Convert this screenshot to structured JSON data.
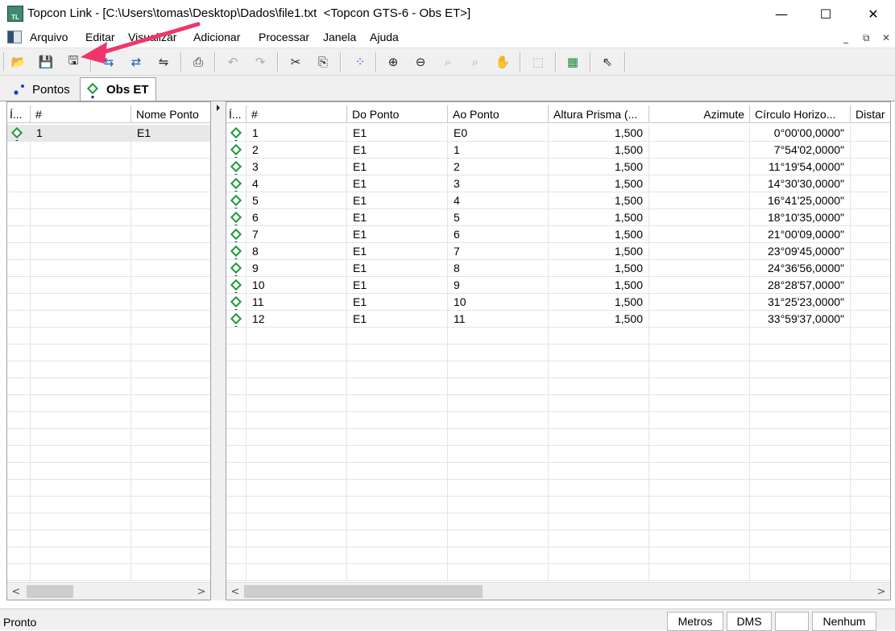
{
  "window": {
    "title": "Topcon Link - [C:\\Users\\tomas\\Desktop\\Dados\\file1.txt  <Topcon GTS-6 - Obs ET>]",
    "app_icon_text": "TL",
    "controls": {
      "minimize": "—",
      "maximize": "☐",
      "close": "✕"
    }
  },
  "menu": {
    "items": [
      "Arquivo",
      "Editar",
      "Visualizar",
      "Adicionar",
      "Processar",
      "Janela",
      "Ajuda"
    ],
    "mdi_controls": [
      "_",
      "⧉",
      "✕"
    ]
  },
  "toolbar": {
    "buttons": [
      {
        "icon": "open-folder-icon",
        "glyph": "📂"
      },
      {
        "icon": "save-disabled-icon",
        "glyph": "💾"
      },
      {
        "icon": "save-as-icon",
        "glyph": "🖫"
      },
      {
        "icon": "import-icon",
        "glyph": "⇆"
      },
      {
        "icon": "export-icon",
        "glyph": "⇄"
      },
      {
        "icon": "convert-icon",
        "glyph": "⇋"
      },
      {
        "icon": "print-icon",
        "glyph": "⎙"
      },
      {
        "icon": "undo-icon",
        "glyph": "↶"
      },
      {
        "icon": "redo-icon",
        "glyph": "↷"
      },
      {
        "icon": "cut-icon",
        "glyph": "✂"
      },
      {
        "icon": "copy-icon",
        "glyph": "⎘"
      },
      {
        "icon": "add-point-icon",
        "glyph": "⁘"
      },
      {
        "icon": "zoom-in-icon",
        "glyph": "⊕"
      },
      {
        "icon": "zoom-out-icon",
        "glyph": "⊖"
      },
      {
        "icon": "zoom-prev-icon",
        "glyph": "⌕"
      },
      {
        "icon": "zoom-extents-icon",
        "glyph": "⌕"
      },
      {
        "icon": "pan-hand-icon",
        "glyph": "✋"
      },
      {
        "icon": "select-region-icon",
        "glyph": "⬚"
      },
      {
        "icon": "spreadsheet-icon",
        "glyph": "▦"
      },
      {
        "icon": "help-pointer-icon",
        "glyph": "⇖"
      }
    ]
  },
  "tabs": [
    {
      "label": "Pontos",
      "active": false
    },
    {
      "label": "Obs ET",
      "active": true
    }
  ],
  "left_grid": {
    "headers": [
      "Í...",
      "#",
      "Nome Ponto"
    ],
    "rows": [
      {
        "num": "1",
        "name": "E1"
      }
    ]
  },
  "right_grid": {
    "headers": [
      "Í...",
      "#",
      "Do Ponto",
      "Ao Ponto",
      "Altura Prisma (...",
      "Azimute",
      "Círculo Horizo...",
      "Distar"
    ],
    "rows": [
      {
        "num": "1",
        "from": "E1",
        "to": "E0",
        "height": "1,500",
        "azimuth": "",
        "hz": "0°00'00,0000\""
      },
      {
        "num": "2",
        "from": "E1",
        "to": "1",
        "height": "1,500",
        "azimuth": "",
        "hz": "7°54'02,0000\""
      },
      {
        "num": "3",
        "from": "E1",
        "to": "2",
        "height": "1,500",
        "azimuth": "",
        "hz": "11°19'54,0000\""
      },
      {
        "num": "4",
        "from": "E1",
        "to": "3",
        "height": "1,500",
        "azimuth": "",
        "hz": "14°30'30,0000\""
      },
      {
        "num": "5",
        "from": "E1",
        "to": "4",
        "height": "1,500",
        "azimuth": "",
        "hz": "16°41'25,0000\""
      },
      {
        "num": "6",
        "from": "E1",
        "to": "5",
        "height": "1,500",
        "azimuth": "",
        "hz": "18°10'35,0000\""
      },
      {
        "num": "7",
        "from": "E1",
        "to": "6",
        "height": "1,500",
        "azimuth": "",
        "hz": "21°00'09,0000\""
      },
      {
        "num": "8",
        "from": "E1",
        "to": "7",
        "height": "1,500",
        "azimuth": "",
        "hz": "23°09'45,0000\""
      },
      {
        "num": "9",
        "from": "E1",
        "to": "8",
        "height": "1,500",
        "azimuth": "",
        "hz": "24°36'56,0000\""
      },
      {
        "num": "10",
        "from": "E1",
        "to": "9",
        "height": "1,500",
        "azimuth": "",
        "hz": "28°28'57,0000\""
      },
      {
        "num": "11",
        "from": "E1",
        "to": "10",
        "height": "1,500",
        "azimuth": "",
        "hz": "31°25'23,0000\""
      },
      {
        "num": "12",
        "from": "E1",
        "to": "11",
        "height": "1,500",
        "azimuth": "",
        "hz": "33°59'37,0000\""
      }
    ]
  },
  "scroll": {
    "left": "<",
    "right": ">"
  },
  "statusbar": {
    "text": "Pronto",
    "units": "Metros",
    "angle": "DMS",
    "blank": "",
    "mode": "Nenhum"
  },
  "colors": {
    "annotation_arrow": "#f0356b",
    "point_icon": "#1f9a3a"
  }
}
